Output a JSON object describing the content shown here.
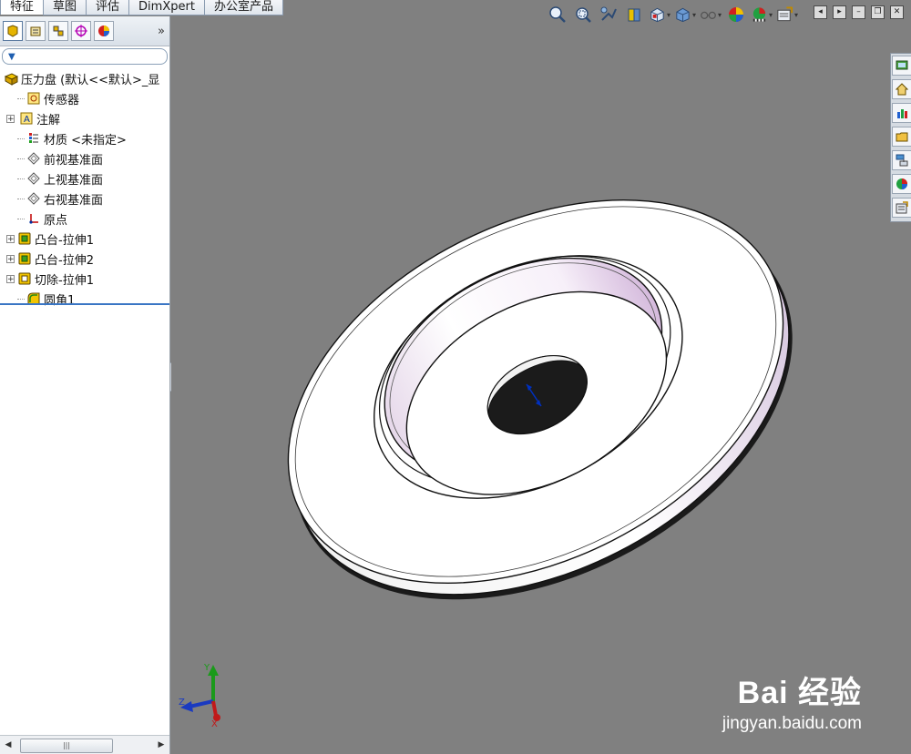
{
  "command_tabs": [
    {
      "label": "特征"
    },
    {
      "label": "草图"
    },
    {
      "label": "评估"
    },
    {
      "label": "DimXpert"
    },
    {
      "label": "办公室产品"
    }
  ],
  "panel_tabs": {
    "more": "»",
    "icons": [
      "feature-manager-icon",
      "property-manager-icon",
      "configuration-manager-icon",
      "dimxpert-manager-icon",
      "display-manager-icon"
    ]
  },
  "filter": {
    "icon": "filter-icon"
  },
  "feature_tree": {
    "root": "压力盘  (默认<<默认>_显",
    "items": [
      {
        "label": "传感器",
        "icon": "sensor-icon",
        "expandable": false
      },
      {
        "label": "注解",
        "icon": "annotation-icon",
        "expandable": true
      },
      {
        "label": "材质 <未指定>",
        "icon": "material-icon",
        "expandable": false
      },
      {
        "label": "前视基准面",
        "icon": "plane-icon",
        "expandable": false
      },
      {
        "label": "上视基准面",
        "icon": "plane-icon",
        "expandable": false
      },
      {
        "label": "右视基准面",
        "icon": "plane-icon",
        "expandable": false
      },
      {
        "label": "原点",
        "icon": "origin-icon",
        "expandable": false
      },
      {
        "label": "凸台-拉伸1",
        "icon": "boss-extrude-icon",
        "expandable": true
      },
      {
        "label": "凸台-拉伸2",
        "icon": "boss-extrude-icon",
        "expandable": true
      },
      {
        "label": "切除-拉伸1",
        "icon": "cut-extrude-icon",
        "expandable": true
      },
      {
        "label": "圆角1",
        "icon": "fillet-icon",
        "expandable": false
      }
    ]
  },
  "heads_up_toolbar": [
    "zoom-to-fit-icon",
    "zoom-to-area-icon",
    "previous-view-icon",
    "section-view-icon",
    "view-orientation-icon",
    "display-style-icon",
    "hide-show-items-icon",
    "edit-appearance-icon",
    "apply-scene-icon",
    "view-settings-icon"
  ],
  "triad": {
    "x": "X",
    "y": "Y",
    "z": "Z"
  },
  "watermark": {
    "brand": "Bai 经验",
    "url": "jingyan.baidu.com"
  },
  "colors": {
    "viewport_bg": "#808080",
    "part_face": "#ffffff",
    "part_edge": "#111111",
    "accent": "#3a76c4"
  }
}
